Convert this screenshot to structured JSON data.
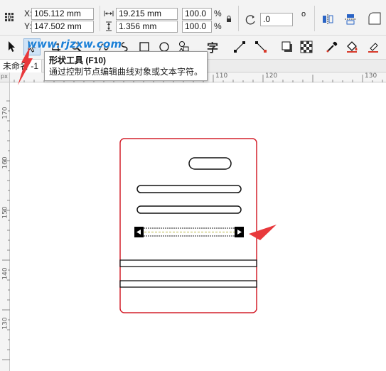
{
  "property_bar": {
    "x_label": "X:",
    "x_value": "105.112 mm",
    "y_label": "Y:",
    "y_value": "147.502 mm",
    "width_value": "19.215 mm",
    "height_value": "1.356 mm",
    "scale_x": "100.0",
    "scale_y": "100.0",
    "percent_sign": "%",
    "rotation_value": ".0",
    "degree_symbol": "o"
  },
  "watermark": {
    "text": "www.rjzxw.com"
  },
  "tooltip": {
    "title": "形状工具 (F10)",
    "description": "通过控制节点编辑曲线对象或文本字符。"
  },
  "document_tab": {
    "label": "未命名 -1"
  },
  "ruler": {
    "horizontal_labels": [
      "110",
      "120",
      "130"
    ],
    "vertical_labels": [
      "170",
      "160",
      "150",
      "140",
      "130"
    ],
    "origin_label": "px"
  },
  "colors": {
    "page_border": "#d4202c",
    "annotation_arrow": "#e8393c",
    "selection": "#000000",
    "watermark": "#1a7fd6"
  }
}
